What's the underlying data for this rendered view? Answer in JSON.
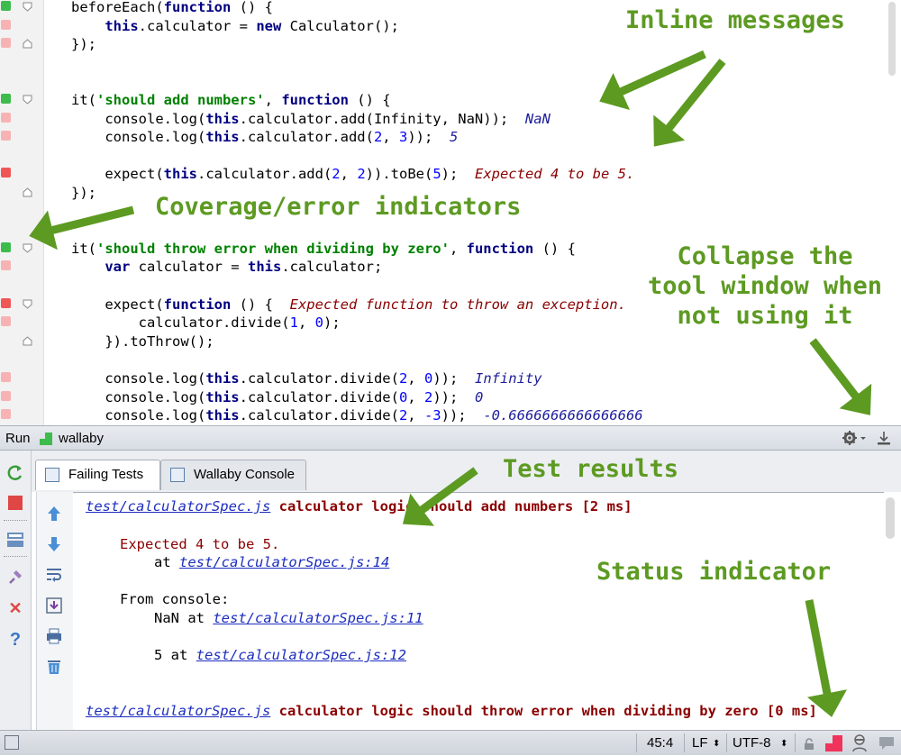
{
  "editor": {
    "lines": [
      {
        "segs": [
          [
            "beforeEach(",
            ""
          ],
          [
            "function",
            "kw"
          ],
          [
            " () {",
            ""
          ]
        ]
      },
      {
        "segs": [
          [
            "    ",
            ""
          ],
          [
            "this",
            "kw"
          ],
          [
            ".calculator = ",
            ""
          ],
          [
            "new",
            "kw"
          ],
          [
            " Calculator();",
            ""
          ]
        ]
      },
      {
        "segs": [
          [
            "});",
            ""
          ]
        ]
      },
      {
        "segs": []
      },
      {
        "segs": []
      },
      {
        "segs": [
          [
            "it(",
            ""
          ],
          [
            "'should add numbers'",
            "str"
          ],
          [
            ", ",
            ""
          ],
          [
            "function",
            "kw"
          ],
          [
            " () {",
            ""
          ]
        ]
      },
      {
        "segs": [
          [
            "    console.log(",
            ""
          ],
          [
            "this",
            "kw"
          ],
          [
            ".calculator.add(Infinity, NaN));  ",
            ""
          ],
          [
            "NaN",
            "inl-ok"
          ]
        ]
      },
      {
        "segs": [
          [
            "    console.log(",
            ""
          ],
          [
            "this",
            "kw"
          ],
          [
            ".calculator.add(",
            ""
          ],
          [
            "2",
            "num"
          ],
          [
            ", ",
            ""
          ],
          [
            "3",
            "num"
          ],
          [
            "));  ",
            ""
          ],
          [
            "5",
            "inl-ok"
          ]
        ]
      },
      {
        "segs": []
      },
      {
        "segs": [
          [
            "    expect(",
            ""
          ],
          [
            "this",
            "kw"
          ],
          [
            ".calculator.add(",
            ""
          ],
          [
            "2",
            "num"
          ],
          [
            ", ",
            ""
          ],
          [
            "2",
            "num"
          ],
          [
            ")).toBe(",
            ""
          ],
          [
            "5",
            "num"
          ],
          [
            ");  ",
            ""
          ],
          [
            "Expected 4 to be 5.",
            "inl-err"
          ]
        ]
      },
      {
        "segs": [
          [
            "});",
            ""
          ]
        ]
      },
      {
        "segs": []
      },
      {
        "segs": []
      },
      {
        "segs": [
          [
            "it(",
            ""
          ],
          [
            "'should throw error when dividing by zero'",
            "str"
          ],
          [
            ", ",
            ""
          ],
          [
            "function",
            "kw"
          ],
          [
            " () {",
            ""
          ]
        ]
      },
      {
        "segs": [
          [
            "    ",
            ""
          ],
          [
            "var",
            "kw"
          ],
          [
            " calculator = ",
            ""
          ],
          [
            "this",
            "kw"
          ],
          [
            ".calculator;",
            ""
          ]
        ]
      },
      {
        "segs": []
      },
      {
        "segs": [
          [
            "    expect(",
            ""
          ],
          [
            "function",
            "kw"
          ],
          [
            " () {  ",
            ""
          ],
          [
            "Expected function to throw an exception.",
            "inl-err"
          ]
        ]
      },
      {
        "segs": [
          [
            "        calculator.divide(",
            ""
          ],
          [
            "1",
            "num"
          ],
          [
            ", ",
            ""
          ],
          [
            "0",
            "num"
          ],
          [
            ");",
            ""
          ]
        ]
      },
      {
        "segs": [
          [
            "    }).toThrow();",
            ""
          ]
        ]
      },
      {
        "segs": []
      },
      {
        "segs": [
          [
            "    console.log(",
            ""
          ],
          [
            "this",
            "kw"
          ],
          [
            ".calculator.divide(",
            ""
          ],
          [
            "2",
            "num"
          ],
          [
            ", ",
            ""
          ],
          [
            "0",
            "num"
          ],
          [
            "));  ",
            ""
          ],
          [
            "Infinity",
            "inl-ok"
          ]
        ]
      },
      {
        "segs": [
          [
            "    console.log(",
            ""
          ],
          [
            "this",
            "kw"
          ],
          [
            ".calculator.divide(",
            ""
          ],
          [
            "0",
            "num"
          ],
          [
            ", ",
            ""
          ],
          [
            "2",
            "num"
          ],
          [
            "));  ",
            ""
          ],
          [
            "0",
            "inl-ok"
          ]
        ]
      },
      {
        "segs": [
          [
            "    console.log(",
            ""
          ],
          [
            "this",
            "kw"
          ],
          [
            ".calculator.divide(",
            ""
          ],
          [
            "2",
            "num"
          ],
          [
            ", ",
            ""
          ],
          [
            "-3",
            "num"
          ],
          [
            "));  ",
            ""
          ],
          [
            "-0.6666666666666666",
            "inl-ok"
          ]
        ]
      }
    ],
    "coverage": [
      "green",
      "pink",
      "pink",
      "none",
      "none",
      "green",
      "pink",
      "pink",
      "none",
      "red",
      "none",
      "none",
      "none",
      "green",
      "pink",
      "none",
      "red",
      "pink",
      "none",
      "none",
      "pink",
      "pink",
      "pink"
    ]
  },
  "toolwindow": {
    "run_label": "Run",
    "config_name": "wallaby",
    "tabs": [
      {
        "label": "Failing Tests",
        "active": true
      },
      {
        "label": "Wallaby Console",
        "active": false
      }
    ]
  },
  "results": {
    "test1_file": "test/calculatorSpec.js",
    "test1_name": " calculator logic should add numbers [2 ms]",
    "error_message": "Expected 4 to be 5.",
    "at_prefix": "at ",
    "error_location": "test/calculatorSpec.js:14",
    "console_header": "From console:",
    "console1_value": "NaN at ",
    "console1_location": "test/calculatorSpec.js:11",
    "console2_value": "5 at ",
    "console2_location": "test/calculatorSpec.js:12",
    "test2_file": "test/calculatorSpec.js",
    "test2_name": " calculator logic should throw error when dividing by zero [0 ms]"
  },
  "statusbar": {
    "position": "45:4",
    "line_ending": "LF",
    "encoding": "UTF-8"
  },
  "annotations": {
    "inline_messages": "Inline messages",
    "coverage_indicators": "Coverage/error indicators",
    "collapse": "Collapse the\ntool window when\nnot using it",
    "test_results": "Test results",
    "status_indicator": "Status indicator"
  },
  "colors": {
    "annotation": "#5d9a22",
    "coverage_green": "#3dbb4c",
    "coverage_pink": "#f7b3b3",
    "coverage_red": "#ef5656",
    "error_text": "#8b0000",
    "link": "#1c2dbf"
  }
}
